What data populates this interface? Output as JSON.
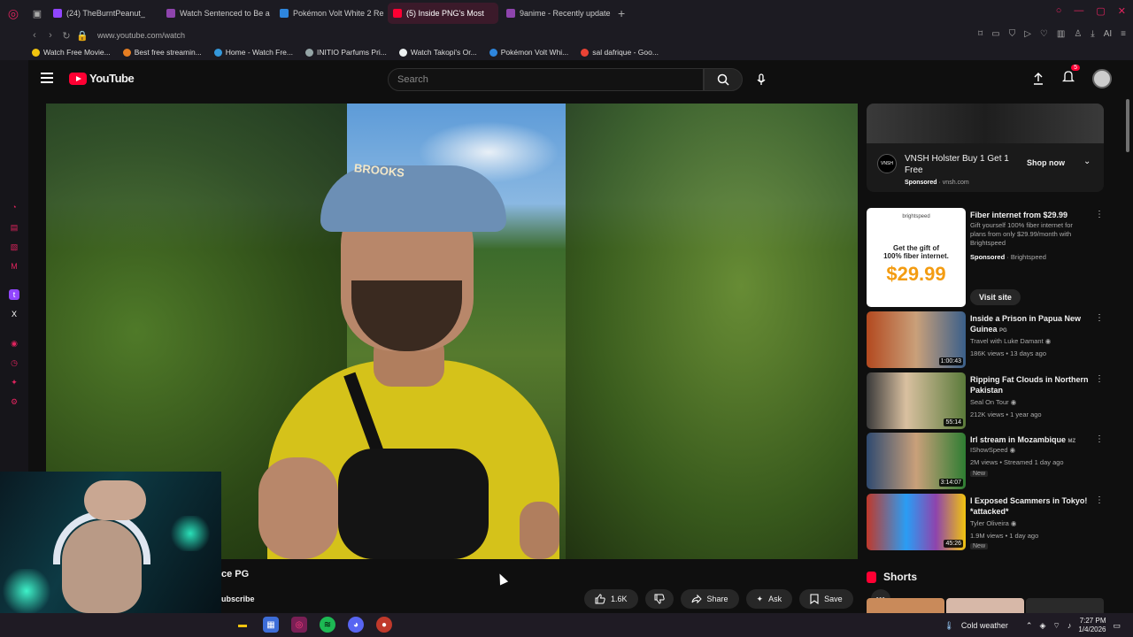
{
  "browser": {
    "tabs": [
      {
        "label": "(24) TheBurntPeanut_",
        "color": "#9146ff"
      },
      {
        "label": "Watch Sentenced to Be a",
        "color": "#8e44ad"
      },
      {
        "label": "Pokémon Volt White 2 Re",
        "color": "#2e86de"
      },
      {
        "label": "(5) Inside PNG's Most",
        "color": "#ff0033",
        "active": true
      },
      {
        "label": "9anime - Recently update",
        "color": "#8e44ad"
      }
    ],
    "url": "www.youtube.com/watch",
    "bookmarks": [
      {
        "label": "Watch Free Movie...",
        "color": "#f1c40f"
      },
      {
        "label": "Best free streamin...",
        "color": "#e67e22"
      },
      {
        "label": "Home - Watch Fre...",
        "color": "#3498db"
      },
      {
        "label": "INITIO Parfums Pri...",
        "color": "#95a5a6"
      },
      {
        "label": "Watch Takopi's Or...",
        "color": "#ecf0f1"
      },
      {
        "label": "Pokémon Volt Whi...",
        "color": "#2e86de"
      },
      {
        "label": "sal dafrique - Goo...",
        "color": "#ea4335"
      }
    ]
  },
  "youtube": {
    "logo": "YouTube",
    "search_placeholder": "Search",
    "notifications_count": "5"
  },
  "video": {
    "cap_text": "BROOKS",
    "title_fragment": "ce PG",
    "subscribe_fragment": "ubscribe",
    "likes": "1.6K",
    "share_label": "Share",
    "ask_label": "Ask",
    "save_label": "Save"
  },
  "ad": {
    "title": "VNSH Holster Buy 1 Get 1 Free",
    "sponsored": "Sponsored",
    "domain": "vnsh.com",
    "cta": "Shop now",
    "logo_text": "VNSH"
  },
  "sponsored_video": {
    "title": "Fiber internet from $29.99",
    "desc": "Gift yourself 100% fiber internet for plans from only $29.99/month with Brightspeed",
    "sponsored": "Sponsored",
    "advertiser": "Brightspeed",
    "cta": "Visit site",
    "thumb_top": "brightspeed",
    "thumb_line1": "Get the gift of",
    "thumb_line2": "100% fiber internet.",
    "thumb_price": "$29.99"
  },
  "recommendations": [
    {
      "title": "Inside a Prison in Papua New Guinea",
      "badge": "PG",
      "channel": "Travel with Luke Damant",
      "meta": "186K views • 13 days ago",
      "duration": "1:00:43",
      "new": ""
    },
    {
      "title": "Ripping Fat Clouds in Northern Pakistan",
      "badge": "",
      "channel": "Seal On Tour",
      "meta": "212K views • 1 year ago",
      "duration": "55:14",
      "new": ""
    },
    {
      "title": "Irl stream in Mozambique",
      "badge": "MZ",
      "channel": "IShowSpeed",
      "meta": "2M views • Streamed 1 day ago",
      "duration": "3:14:07",
      "new": "New"
    },
    {
      "title": "I Exposed Scammers in Tokyo! *attacked*",
      "badge": "",
      "channel": "Tyler Oliveira",
      "meta": "1.9M views • 1 day ago",
      "duration": "45:26",
      "new": "New"
    }
  ],
  "shorts_label": "Shorts",
  "taskbar": {
    "weather": "Cold weather",
    "time": "7:27 PM",
    "date": "1/4/2026"
  }
}
